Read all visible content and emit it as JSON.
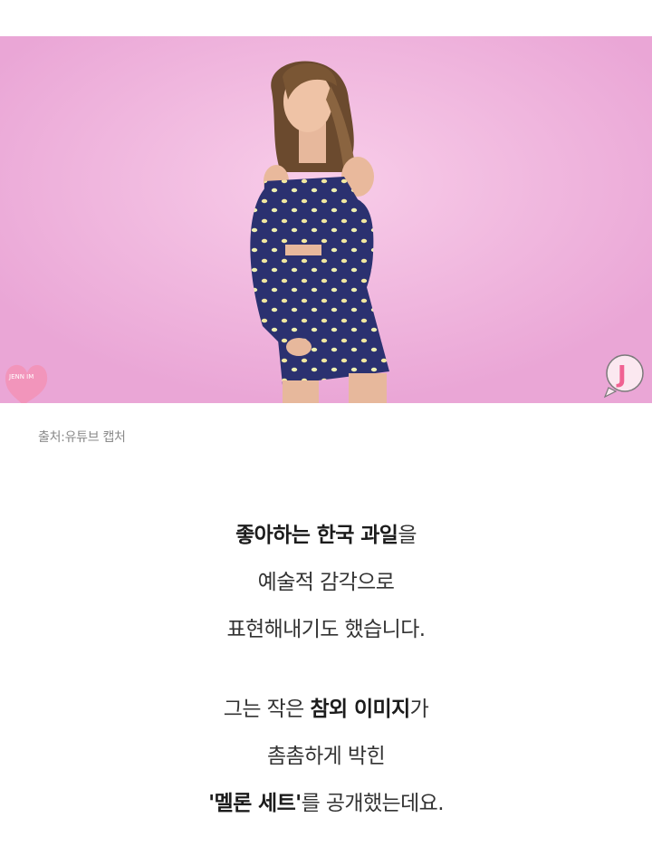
{
  "image": {
    "alt_subject": "woman-in-navy-polka-dot-outfit",
    "background_color": "#f0b5dd",
    "outfit_color": "#2a2f6e",
    "dot_color": "#f3eaa0",
    "left_watermark": "JENN IM",
    "right_watermark": "J"
  },
  "caption": "출처:유튜브 캡처",
  "paragraph1": {
    "line1_bold": "좋아하는 한국 과일",
    "line1_rest": "을",
    "line2": "예술적 감각으로",
    "line3": "표현해내기도 했습니다."
  },
  "paragraph2": {
    "line1_pre": "그는 작은 ",
    "line1_bold": "참외 이미지",
    "line1_rest": "가",
    "line2": "촘촘하게 박힌",
    "line3_bold": "'멜론 세트'",
    "line3_rest": "를 공개했는데요."
  }
}
